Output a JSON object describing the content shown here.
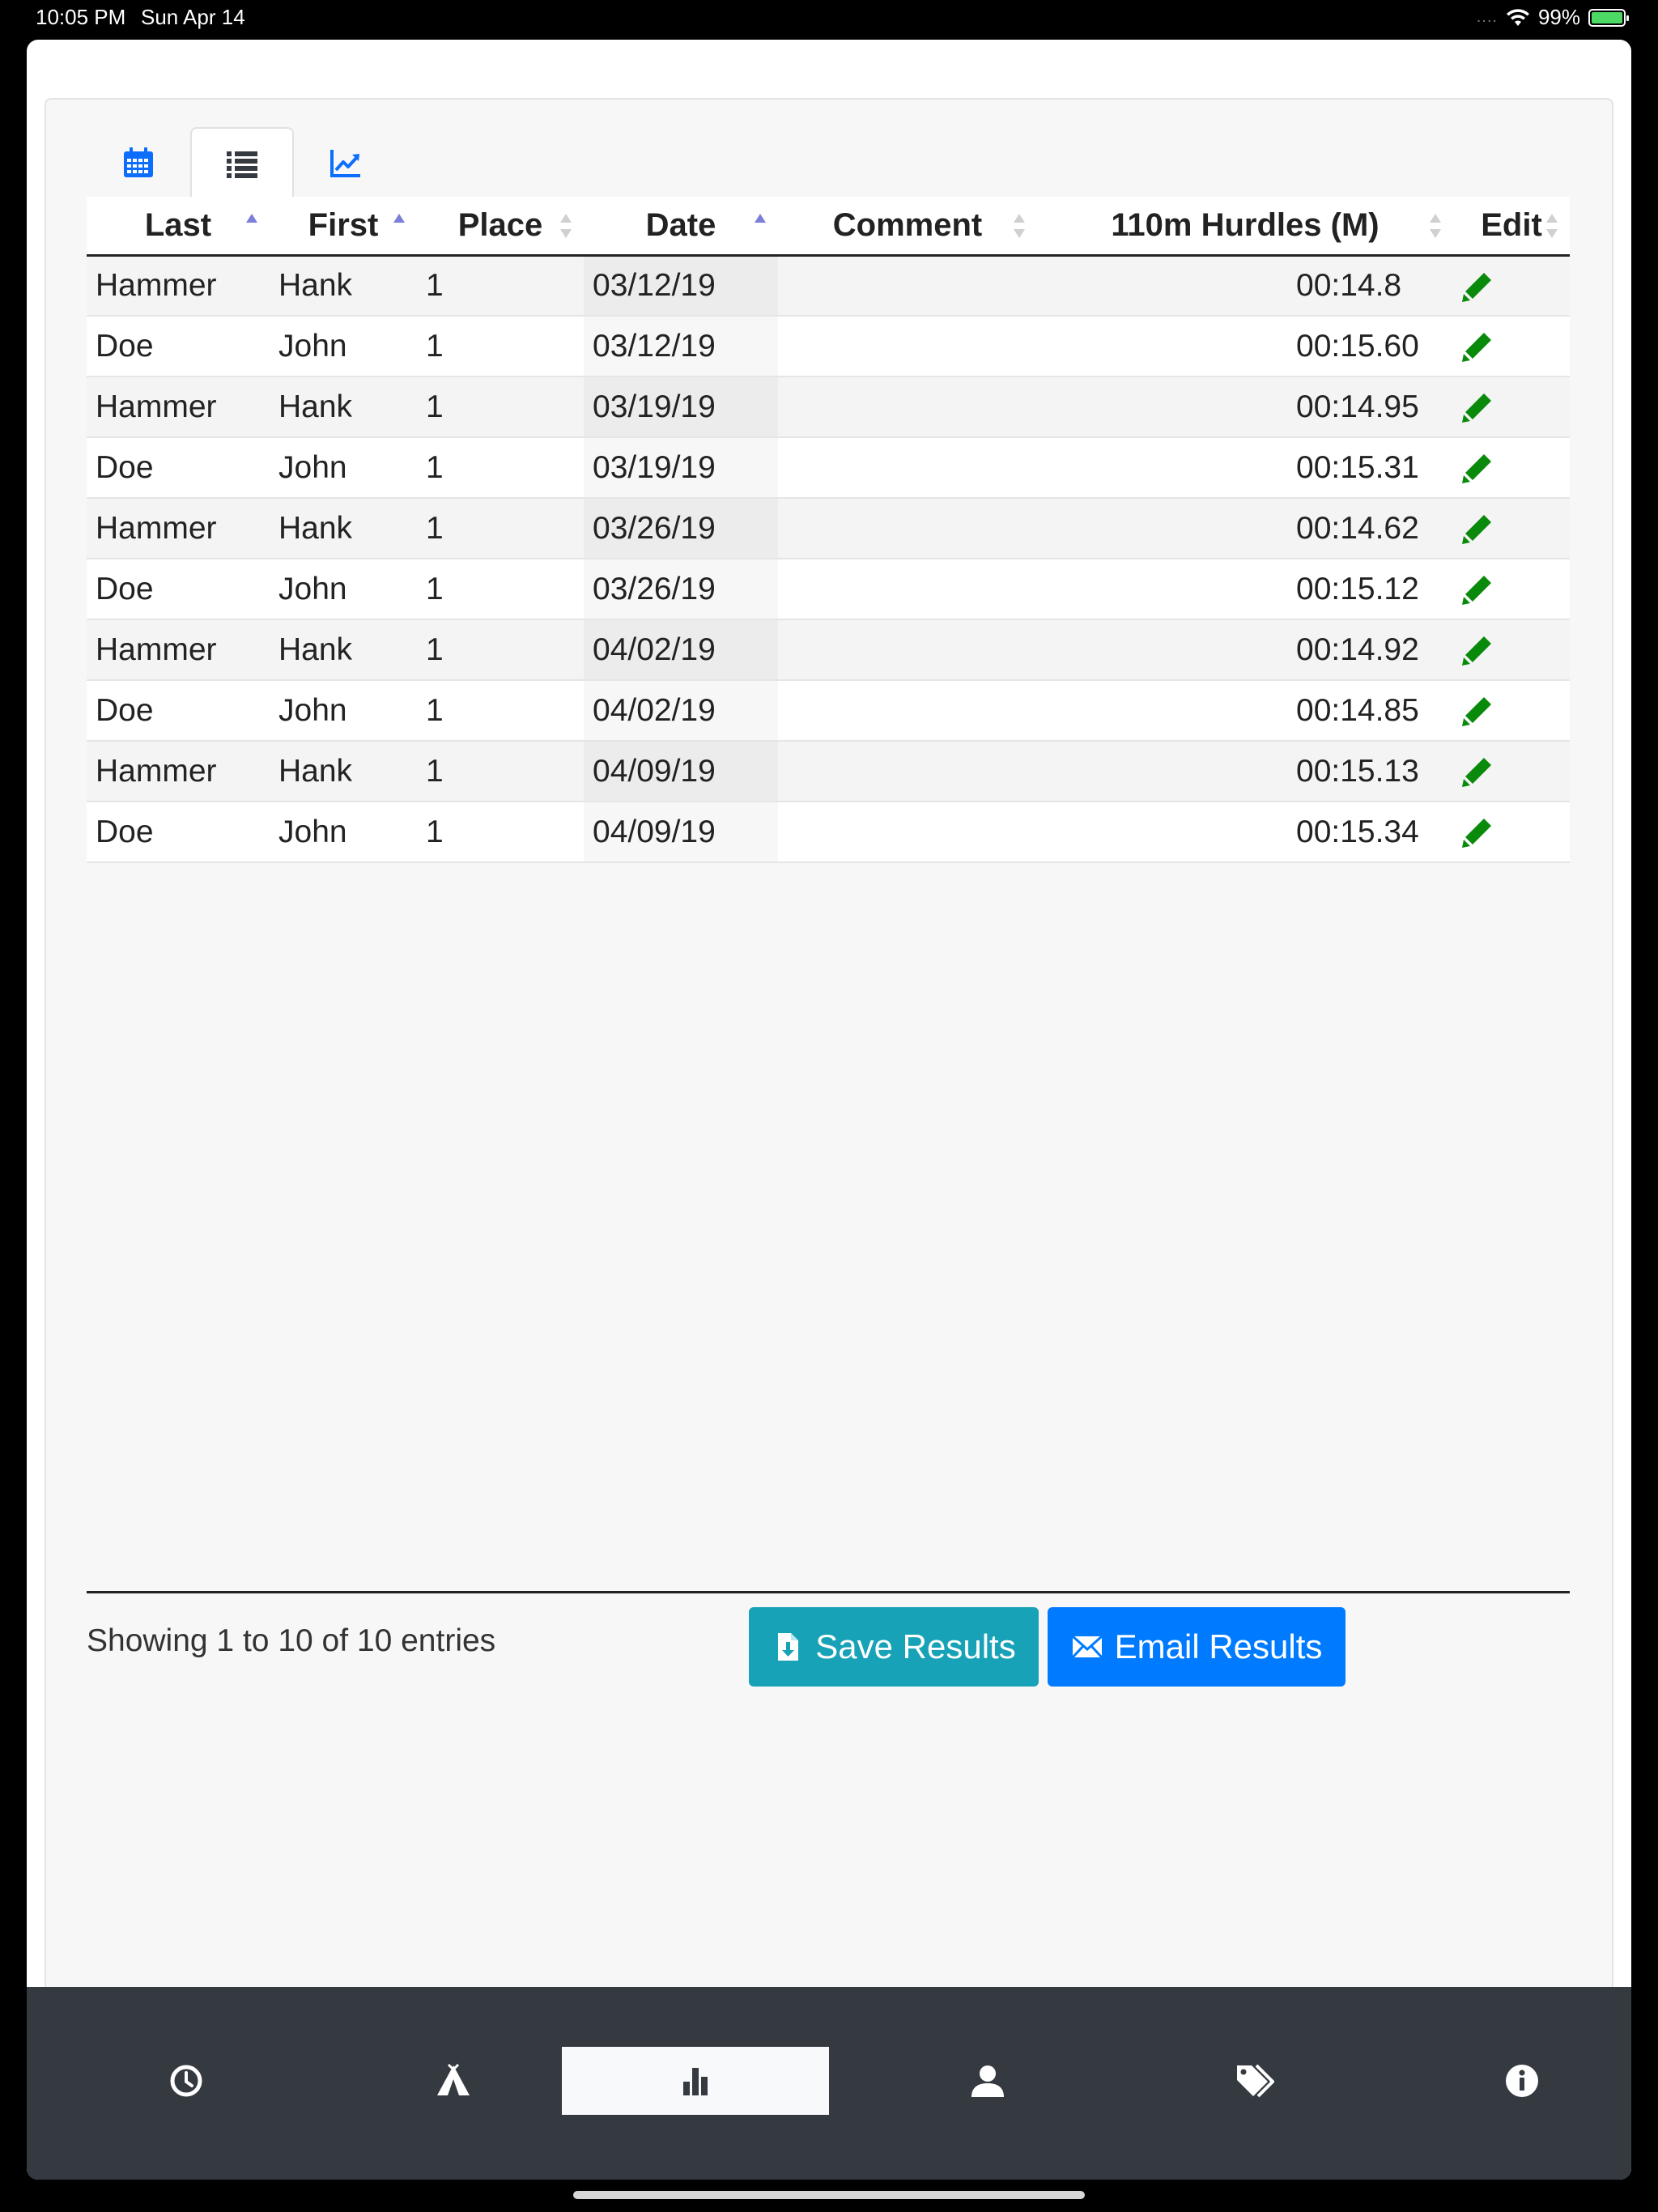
{
  "status_bar": {
    "time": "10:05 PM",
    "date": "Sun Apr 14",
    "signal": "....",
    "battery": "99%",
    "battery_level": 0.99
  },
  "tabs": [
    {
      "icon": "calendar-icon",
      "active": false
    },
    {
      "icon": "list-icon",
      "active": true
    },
    {
      "icon": "line-chart-icon",
      "active": false
    }
  ],
  "table": {
    "columns": [
      {
        "label": "Last",
        "sort": "asc"
      },
      {
        "label": "First",
        "sort": "asc"
      },
      {
        "label": "Place",
        "sort": "none"
      },
      {
        "label": "Date",
        "sort": "asc"
      },
      {
        "label": "Comment",
        "sort": "none"
      },
      {
        "label": "110m Hurdles (M)",
        "sort": "none"
      },
      {
        "label": "Edit",
        "sort": "none"
      }
    ],
    "rows": [
      {
        "last": "Hammer",
        "first": "Hank",
        "place": "1",
        "date": "03/12/19",
        "comment": "",
        "time": "00:14.8"
      },
      {
        "last": "Doe",
        "first": "John",
        "place": "1",
        "date": "03/12/19",
        "comment": "",
        "time": "00:15.60"
      },
      {
        "last": "Hammer",
        "first": "Hank",
        "place": "1",
        "date": "03/19/19",
        "comment": "",
        "time": "00:14.95"
      },
      {
        "last": "Doe",
        "first": "John",
        "place": "1",
        "date": "03/19/19",
        "comment": "",
        "time": "00:15.31"
      },
      {
        "last": "Hammer",
        "first": "Hank",
        "place": "1",
        "date": "03/26/19",
        "comment": "",
        "time": "00:14.62"
      },
      {
        "last": "Doe",
        "first": "John",
        "place": "1",
        "date": "03/26/19",
        "comment": "",
        "time": "00:15.12"
      },
      {
        "last": "Hammer",
        "first": "Hank",
        "place": "1",
        "date": "04/02/19",
        "comment": "",
        "time": "00:14.92"
      },
      {
        "last": "Doe",
        "first": "John",
        "place": "1",
        "date": "04/02/19",
        "comment": "",
        "time": "00:14.85"
      },
      {
        "last": "Hammer",
        "first": "Hank",
        "place": "1",
        "date": "04/09/19",
        "comment": "",
        "time": "00:15.13"
      },
      {
        "last": "Doe",
        "first": "John",
        "place": "1",
        "date": "04/09/19",
        "comment": "",
        "time": "00:15.34"
      }
    ]
  },
  "footer": {
    "entries_text": "Showing 1 to 10 of 10 entries",
    "save_label": "Save Results",
    "email_label": "Email Results"
  },
  "bottom_nav": [
    {
      "icon": "clock-icon",
      "active": false
    },
    {
      "icon": "tent-icon",
      "active": false
    },
    {
      "icon": "bar-chart-icon",
      "active": true
    },
    {
      "icon": "user-icon",
      "active": false
    },
    {
      "icon": "tags-icon",
      "active": false
    },
    {
      "icon": "info-icon",
      "active": false
    }
  ],
  "colors": {
    "accent_blue": "#007bff",
    "teal": "#17a2b8",
    "edit_green": "#0a8a0a",
    "sort_active": "#7b7fd9",
    "sort_inactive": "#d0d0d0",
    "nav_bg": "#343a40"
  }
}
